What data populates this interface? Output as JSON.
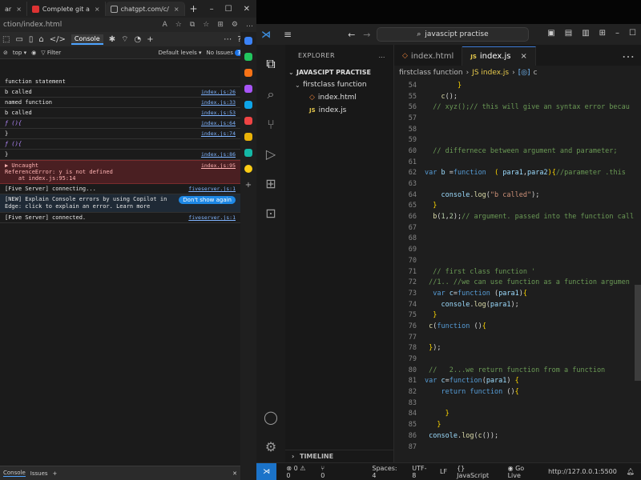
{
  "browser": {
    "tabs": [
      {
        "label": "ar",
        "active": false
      },
      {
        "label": "Complete git a",
        "active": false
      },
      {
        "label": "chatgpt.com/c/",
        "active": true
      }
    ],
    "new_tab": "+",
    "url": "ction/index.html",
    "devtools": {
      "console_tab": "Console",
      "context": "top",
      "filter_placeholder": "Filter",
      "levels": "Default levels",
      "issues_label": "No Issues",
      "issues_count": "3"
    },
    "console_rows": [
      {
        "text": "function statement",
        "src": ""
      },
      {
        "text": "b called",
        "src": "index.js:26"
      },
      {
        "text": "named function",
        "src": "index.js:33"
      },
      {
        "text": "b called",
        "src": "index.js:53"
      },
      {
        "text": "ƒ (){",
        "src": "index.js:64"
      },
      {
        "text": "}",
        "src": "index.js:74"
      },
      {
        "text": "ƒ (){",
        "src": ""
      },
      {
        "text": "}",
        "src": "index.js:86"
      },
      {
        "text": "▶ Uncaught\nReferenceError: y is not defined\n    at index.js:95:14",
        "src": "index.js:95"
      },
      {
        "text": "[Five Server] connecting...",
        "src": "fiveserver.js:1"
      },
      {
        "text": "[NEW] Explain Console errors by using Copilot in Edge: click  to explain an error. Learn more",
        "src": "",
        "button": "Don't show again"
      },
      {
        "text": "[Five Server] connected.",
        "src": "fiveserver.js:1"
      }
    ],
    "drawer": {
      "tab1": "Console",
      "tab2": "Issues",
      "add": "+"
    }
  },
  "vscode": {
    "command_center": "javascipt practise",
    "explorer_title": "EXPLORER",
    "project": "JAVASCIPT PRACTISE",
    "folder": "firstclass function",
    "files": [
      "index.html",
      "index.js"
    ],
    "timeline": "TIMELINE",
    "tabs": [
      {
        "label": "index.html",
        "active": false
      },
      {
        "label": "index.js",
        "active": true
      }
    ],
    "breadcrumbs": [
      "firstclass function",
      "JS index.js",
      "c"
    ],
    "statusbar": {
      "problems": "⊗ 0 ⚠ 0",
      "ports": "⑂ 0",
      "spaces": "Spaces: 4",
      "encoding": "UTF-8",
      "eol": "LF",
      "language": "{} JavaScript",
      "golive": "Go Live",
      "server": "http://127.0.0.1:5500"
    },
    "code_lines": [
      {
        "n": "54",
        "html": "        <span class='br'>}</span>"
      },
      {
        "n": "55",
        "html": "    <span class='fn'>c</span>();"
      },
      {
        "n": "56",
        "html": "  <span class='cm'>// xyz();// this will give an syntax error becau</span>"
      },
      {
        "n": "57",
        "html": ""
      },
      {
        "n": "58",
        "html": ""
      },
      {
        "n": "59",
        "html": ""
      },
      {
        "n": "60",
        "html": "  <span class='cm'>// differnece between argument and parameter;</span>"
      },
      {
        "n": "61",
        "html": ""
      },
      {
        "n": "62",
        "html": "<span class='kw'>var</span> <span class='pm'>b</span> =<span class='kw'>function</span>  <span class='br'>(</span> <span class='pm'>para1</span>,<span class='pm'>para2</span><span class='br'>)</span><span class='br'>{</span><span class='cm'>//parameter .this</span>"
      },
      {
        "n": "63",
        "html": ""
      },
      {
        "n": "64",
        "html": "    <span class='pm'>console</span>.<span class='fn'>log</span>(<span class='str'>\"b called\"</span>);"
      },
      {
        "n": "65",
        "html": "  <span class='br'>}</span>"
      },
      {
        "n": "66",
        "html": "  <span class='fn'>b</span>(<span class='num'>1</span>,<span class='num'>2</span>);<span class='cm'>// argument. passed into the function call</span>"
      },
      {
        "n": "67",
        "html": ""
      },
      {
        "n": "68",
        "html": ""
      },
      {
        "n": "69",
        "html": ""
      },
      {
        "n": "70",
        "html": ""
      },
      {
        "n": "71",
        "html": "  <span class='cm'>// first class function '</span>"
      },
      {
        "n": "72",
        "html": " <span class='cm'>//1.. //we can use function as a function argumen</span>"
      },
      {
        "n": "73",
        "html": "  <span class='kw'>var</span> <span class='pm'>c</span>=<span class='kw'>function</span> (<span class='pm'>para1</span>)<span class='br'>{</span>"
      },
      {
        "n": "74",
        "html": "    <span class='pm'>console</span>.<span class='fn'>log</span>(<span class='pm'>para1</span>);"
      },
      {
        "n": "75",
        "html": "  <span class='br'>}</span>"
      },
      {
        "n": "76",
        "html": " <span class='fn'>c</span>(<span class='kw'>function</span> ()<span class='br'>{</span>"
      },
      {
        "n": "77",
        "html": ""
      },
      {
        "n": "78",
        "html": " <span class='br'>}</span>);"
      },
      {
        "n": "79",
        "html": ""
      },
      {
        "n": "80",
        "html": " <span class='cm'>//   2...we return function from a function</span>"
      },
      {
        "n": "81",
        "html": "<span class='kw'>var</span> <span class='pm'>c</span>=<span class='kw'>function</span>(<span class='pm'>para1</span>) <span class='br'>{</span>"
      },
      {
        "n": "82",
        "html": "    <span class='kw'>return</span> <span class='kw'>function</span> ()<span class='br'>{</span>"
      },
      {
        "n": "83",
        "html": ""
      },
      {
        "n": "84",
        "html": "     <span class='br'>}</span>"
      },
      {
        "n": "85",
        "html": "   <span class='br'>}</span>"
      },
      {
        "n": "86",
        "html": " <span class='pm'>console</span>.<span class='fn'>log</span>(<span class='fn'>c</span>());"
      },
      {
        "n": "87",
        "html": ""
      }
    ]
  },
  "colors": {
    "accent": "#3d7bd6",
    "error_bg": "#4a1f22",
    "remote": "#1b73c9"
  }
}
